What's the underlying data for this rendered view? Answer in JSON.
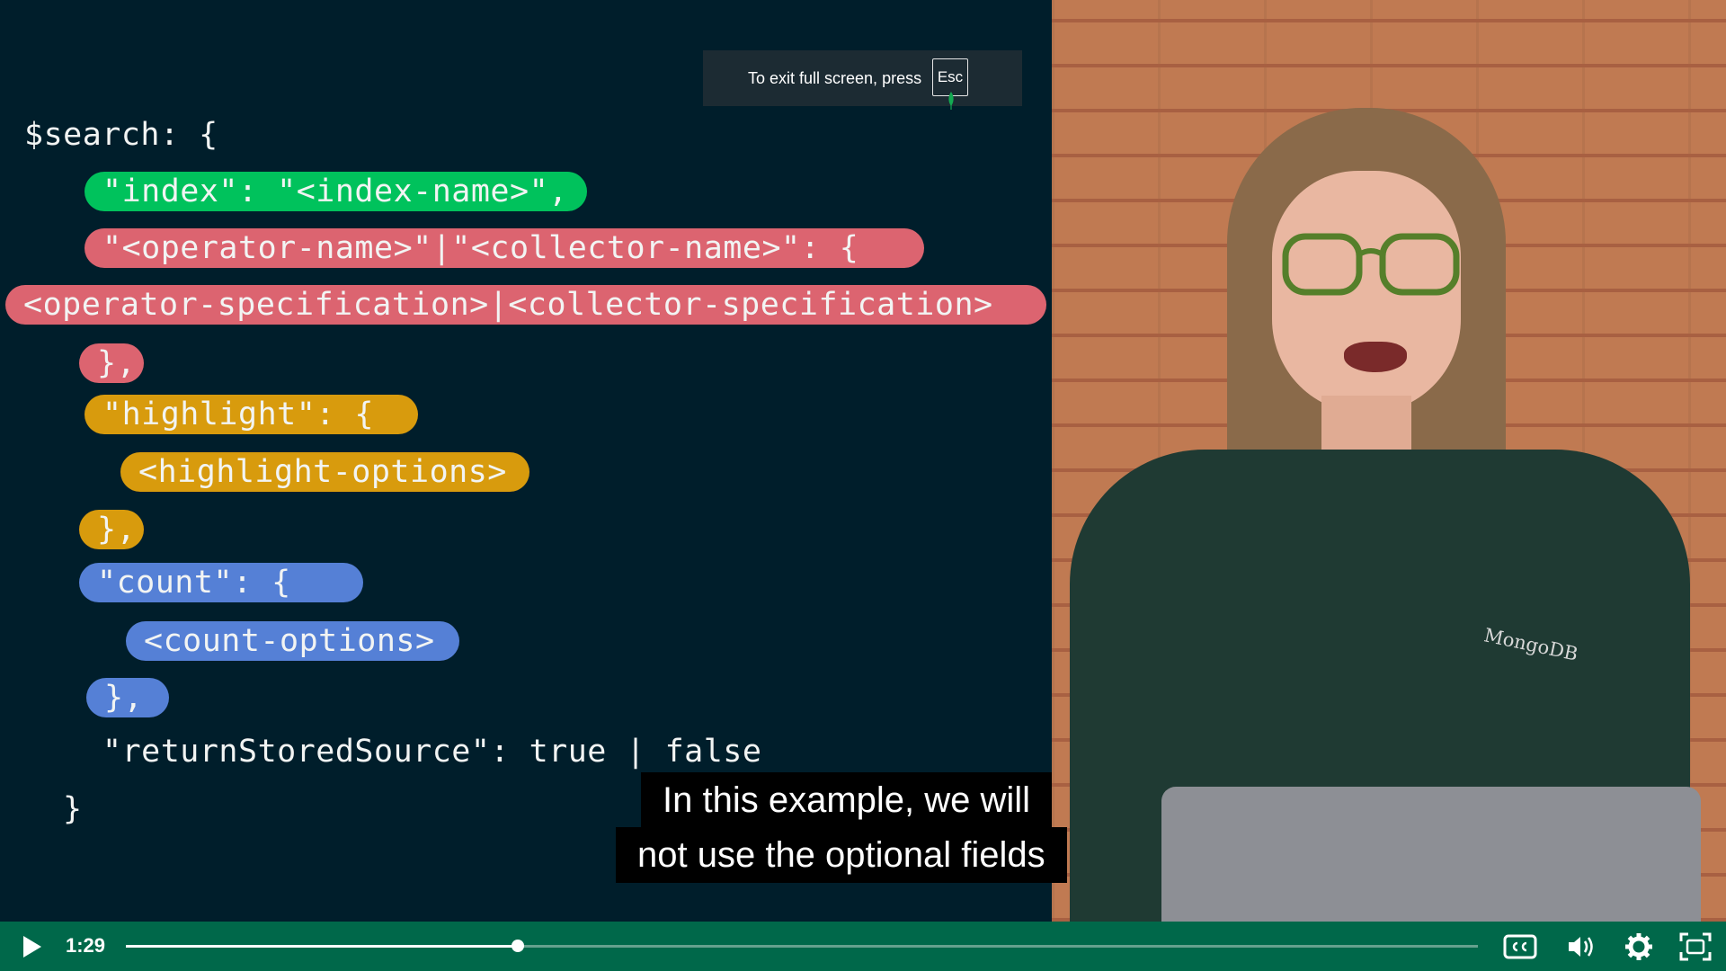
{
  "code": {
    "line1": "$search: {",
    "line2": "\"index\": \"<index-name>\",",
    "line3": "\"<operator-name>\"|\"<collector-name>\": {",
    "line4": "<operator-specification>|<collector-specification>",
    "line5": "},",
    "line6": "\"highlight\": {",
    "line7": "<highlight-options>",
    "line8": "},",
    "line9": "\"count\": {",
    "line10": "<count-options>",
    "line11": "},",
    "line12": "\"returnStoredSource\": true | false",
    "line13": "}"
  },
  "colors": {
    "green": "#00c25c",
    "red": "#dc6470",
    "yellow": "#d89b0d",
    "blue": "#5580d6",
    "code_bg": "#001e2b",
    "controls_bg": "#00684a"
  },
  "fullscreen_tooltip": {
    "text": "To exit full screen, press",
    "key": "Esc"
  },
  "shirt_logo": "MongoDB",
  "subtitles": {
    "line1": "In this example, we will",
    "line2": "not use the optional fields"
  },
  "player": {
    "time": "1:29",
    "progress": 0.29,
    "icons": [
      "play-icon",
      "closed-captions-icon",
      "volume-icon",
      "settings-gear-icon",
      "fullscreen-icon"
    ]
  }
}
